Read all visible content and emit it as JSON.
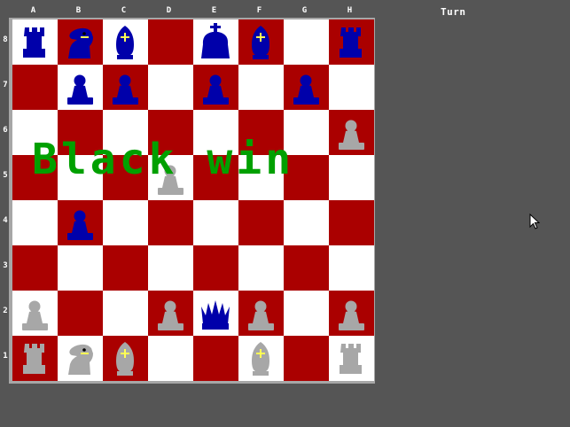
{
  "files": [
    "A",
    "B",
    "C",
    "D",
    "E",
    "F",
    "G",
    "H"
  ],
  "ranks": [
    "8",
    "7",
    "6",
    "5",
    "4",
    "3",
    "2",
    "1"
  ],
  "turn_label": "Turn",
  "status_banner": "Black win",
  "colors": {
    "light_square": "#ffffff",
    "dark_square": "#aa0000",
    "black_piece": "#0000aa",
    "white_piece": "#a7a7a7",
    "background": "#555555",
    "banner": "#00a000"
  },
  "pieces": [
    {
      "square": "a8",
      "color": "black",
      "type": "rook"
    },
    {
      "square": "b8",
      "color": "black",
      "type": "knight"
    },
    {
      "square": "c8",
      "color": "black",
      "type": "bishop"
    },
    {
      "square": "e8",
      "color": "black",
      "type": "king"
    },
    {
      "square": "f8",
      "color": "black",
      "type": "bishop"
    },
    {
      "square": "h8",
      "color": "black",
      "type": "rook"
    },
    {
      "square": "b7",
      "color": "black",
      "type": "pawn"
    },
    {
      "square": "c7",
      "color": "black",
      "type": "pawn"
    },
    {
      "square": "e7",
      "color": "black",
      "type": "pawn"
    },
    {
      "square": "g7",
      "color": "black",
      "type": "pawn"
    },
    {
      "square": "h6",
      "color": "white",
      "type": "pawn"
    },
    {
      "square": "d5",
      "color": "white",
      "type": "pawn"
    },
    {
      "square": "b4",
      "color": "black",
      "type": "pawn"
    },
    {
      "square": "a2",
      "color": "white",
      "type": "pawn"
    },
    {
      "square": "d2",
      "color": "white",
      "type": "pawn"
    },
    {
      "square": "e2",
      "color": "black",
      "type": "queen"
    },
    {
      "square": "f2",
      "color": "white",
      "type": "pawn"
    },
    {
      "square": "h2",
      "color": "white",
      "type": "pawn"
    },
    {
      "square": "a1",
      "color": "white",
      "type": "rook"
    },
    {
      "square": "b1",
      "color": "white",
      "type": "knight"
    },
    {
      "square": "c1",
      "color": "white",
      "type": "bishop"
    },
    {
      "square": "f1",
      "color": "white",
      "type": "bishop"
    },
    {
      "square": "h1",
      "color": "white",
      "type": "rook"
    }
  ]
}
